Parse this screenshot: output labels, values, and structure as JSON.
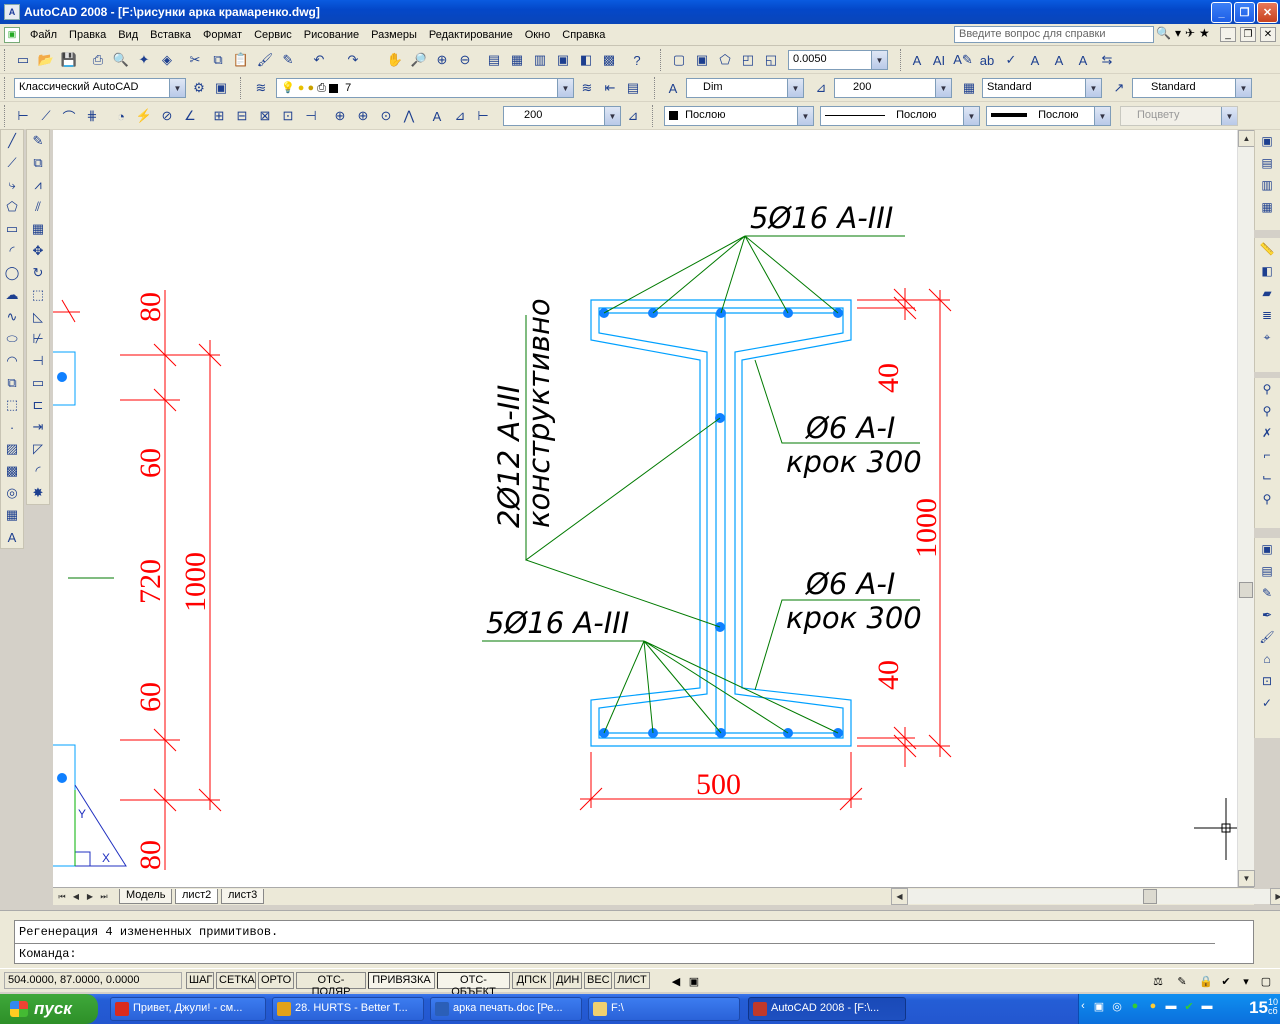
{
  "window": {
    "app_icon_label": "A",
    "title": "AutoCAD 2008 - [F:\\рисунки арка крамаренко.dwg]",
    "minimize_label": "_",
    "maximize_label": "❐",
    "close_label": "✕"
  },
  "menu": {
    "items": [
      "Файл",
      "Правка",
      "Вид",
      "Вставка",
      "Формат",
      "Сервис",
      "Рисование",
      "Размеры",
      "Редактирование",
      "Окно",
      "Справка"
    ],
    "help_placeholder": "Введите вопрос для справки"
  },
  "toolbar1": {
    "precision_value": "0.0050",
    "text_style": "A"
  },
  "toolbar2": {
    "workspace": "Классический AutoCAD",
    "layer_name": "7",
    "dimstyle": "Dim",
    "scale": "200",
    "textstyle": "Standard",
    "tablestyle": "Standard"
  },
  "toolbar3": {
    "dim_scale": "200",
    "color": "Послою",
    "linetype": "Послою",
    "lineweight": "Послою",
    "plotstyle": "Поцвету"
  },
  "drawing": {
    "top_bars_label": "5Ø16 A-III",
    "bottom_bars_label": "5Ø16 A-III",
    "constr_label_line1": "2Ø12 A-III",
    "constr_label_line2": "конструктивно",
    "stirrup1_line1": "Ø6 A-I",
    "stirrup1_line2": "крок 300",
    "stirrup2_line1": "Ø6 A-I",
    "stirrup2_line2": "крок 300",
    "dim_width": "500",
    "dim_height": "1000",
    "dim_top_flange": "40",
    "dim_bottom_flange": "40",
    "left_dim_80_top": "80",
    "left_dim_60_top": "60",
    "left_dim_720": "720",
    "left_dim_1000": "1000",
    "left_dim_60_bottom": "60",
    "left_dim_80_bottom": "80",
    "label_y": "Y",
    "label_x": "X"
  },
  "tabs": {
    "model": "Модель",
    "sheet2": "лист2",
    "sheet3": "лист3"
  },
  "command": {
    "history": "Регенерация 4 измененных примитивов.",
    "prompt": "Команда:"
  },
  "status": {
    "coords": "504.0000, 87.0000, 0.0000",
    "buttons": [
      {
        "label": "ШАГ",
        "on": false
      },
      {
        "label": "СЕТКА",
        "on": false
      },
      {
        "label": "ОРТО",
        "on": false
      },
      {
        "label": "ОТС-ПОЛЯР",
        "on": false
      },
      {
        "label": "ПРИВЯЗКА",
        "on": true
      },
      {
        "label": "ОТС-ОБЪЕКТ",
        "on": true
      },
      {
        "label": "ДПСК",
        "on": false
      },
      {
        "label": "ДИН",
        "on": false
      },
      {
        "label": "ВЕС",
        "on": false
      },
      {
        "label": "ЛИСТ",
        "on": false
      }
    ]
  },
  "taskbar": {
    "start": "пуск",
    "tasks": [
      {
        "label": "Привет, Джули! - см...",
        "color": "#d92b1e"
      },
      {
        "label": "28. HURTS - Better T...",
        "color": "#e3a21a"
      },
      {
        "label": "арка печать.doc [Ре...",
        "color": "#2b5fb8"
      },
      {
        "label": "F:\\",
        "color": "#f0d070"
      },
      {
        "label": "AutoCAD 2008 - [F:\\...",
        "color": "#c0392b"
      }
    ],
    "clock": "15",
    "clock_small_1": "10",
    "clock_small_2": "сб"
  },
  "colors": {
    "dimension": "#ff0000",
    "outline": "#00a0ff",
    "leader": "#007a00",
    "rebar": "#1080ff"
  }
}
